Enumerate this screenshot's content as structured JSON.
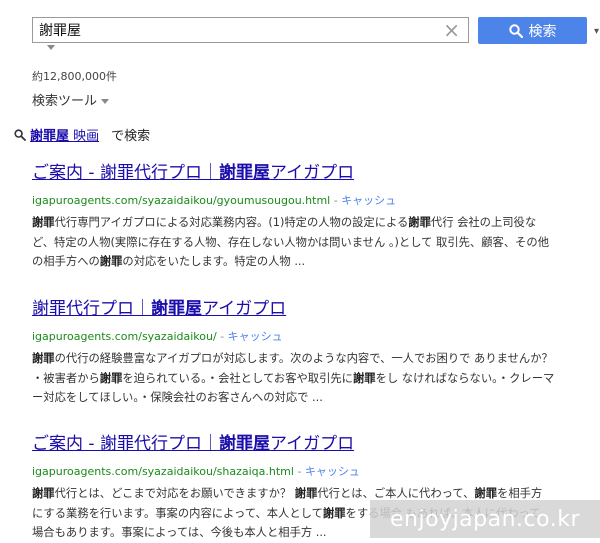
{
  "search": {
    "query": "謝罪屋",
    "clear_icon": "×",
    "button_label": "検索"
  },
  "result_count": "約12,800,000件",
  "tools_label": "検索ツール",
  "suggestion": {
    "term_bold": "謝罪屋",
    "term_rest": " 映画",
    "suffix": "で検索"
  },
  "results": [
    {
      "title_pre": "ご案内 - 謝罪代行プロ｜",
      "title_bold": "謝罪屋",
      "title_post": "アイガプロ",
      "url": "igapuroagents.com/syazaidaikou/gyoumusougou.html",
      "sep": " - ",
      "cache": "キャッシュ",
      "lines": [
        [
          {
            "t": "謝罪",
            "b": true
          },
          {
            "t": "代行専門アイガプロによる対応業務内容。(1)特定の人物の設定による"
          },
          {
            "t": "謝罪",
            "b": true
          },
          {
            "t": "代行 会社の上司役な"
          }
        ],
        [
          {
            "t": "ど、特定の人物(実際に存在する人物、存在しない人物かは問いません 。)として 取引先、顧客、その他"
          }
        ],
        [
          {
            "t": "の相手方への"
          },
          {
            "t": "謝罪",
            "b": true
          },
          {
            "t": "の対応をいたします。特定の人物 ..."
          }
        ]
      ]
    },
    {
      "title_pre": "謝罪代行プロ｜",
      "title_bold": "謝罪屋",
      "title_post": "アイガプロ",
      "url": "igapuroagents.com/syazaidaikou/",
      "sep": " - ",
      "cache": "キャッシュ",
      "lines": [
        [
          {
            "t": "謝罪",
            "b": true
          },
          {
            "t": "の代行の経験豊富なアイガプロが対応します。次のような内容で、一人でお困りで ありませんか？"
          }
        ],
        [
          {
            "t": "・被害者から"
          },
          {
            "t": "謝罪",
            "b": true
          },
          {
            "t": "を迫られている。・会社としてお客や取引先に"
          },
          {
            "t": "謝罪",
            "b": true
          },
          {
            "t": "をし なければならない。・クレーマ"
          }
        ],
        [
          {
            "t": "ー対応をしてほしい。・保険会社のお客さんへの対応で ..."
          }
        ]
      ]
    },
    {
      "title_pre": "ご案内 - 謝罪代行プロ｜",
      "title_bold": "謝罪屋",
      "title_post": "アイガプロ",
      "url": "igapuroagents.com/syazaidaikou/shazaiqa.html",
      "sep": " - ",
      "cache": "キャッシュ",
      "lines": [
        [
          {
            "t": "謝罪",
            "b": true
          },
          {
            "t": "代行とは、どこまで対応をお願いできますか？ "
          },
          {
            "t": "謝罪",
            "b": true
          },
          {
            "t": "代行とは、ご本人に代わって、"
          },
          {
            "t": "謝罪",
            "b": true
          },
          {
            "t": "を相手方"
          }
        ],
        [
          {
            "t": "にする業務を行います。事案の内容によって、本人として"
          },
          {
            "t": "謝罪",
            "b": true
          },
          {
            "t": "をする場合 もあれば、本人に代わって"
          }
        ],
        [
          {
            "t": "場合もあります。事案によっては、今後も本人と相手方 ..."
          }
        ]
      ]
    }
  ],
  "watermark": "enjoyjapan.co.kr",
  "colors": {
    "accent": "#4d84ea",
    "link": "#1a0dab",
    "url": "#1a8a1a"
  },
  "icons": {
    "search": "search-icon",
    "clear": "close-icon"
  }
}
